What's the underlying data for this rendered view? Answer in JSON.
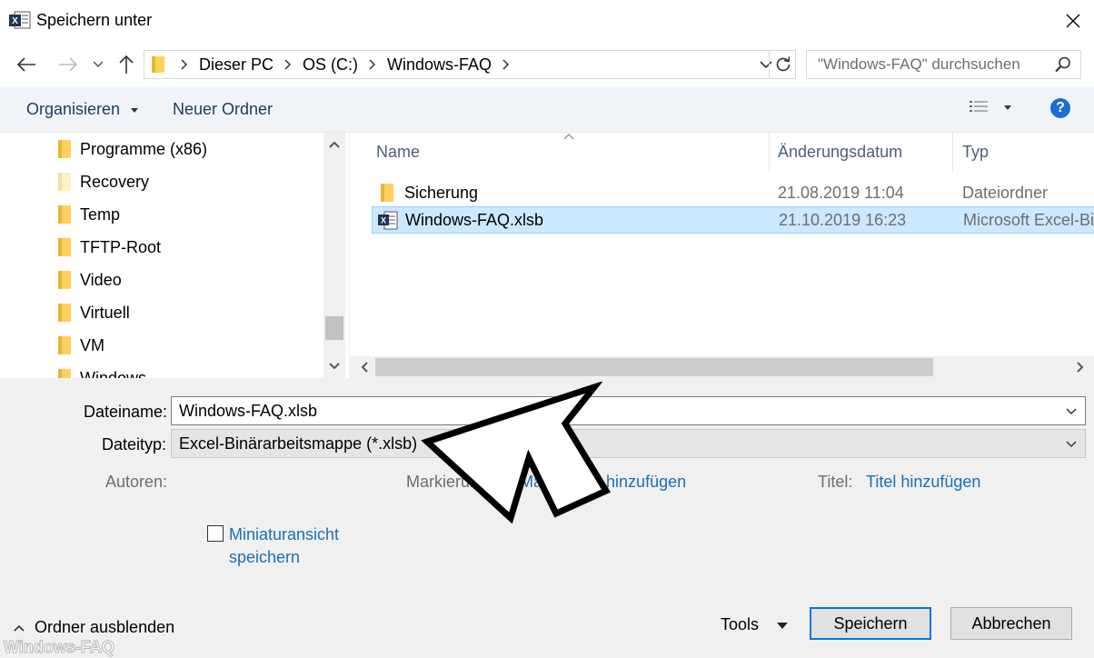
{
  "window": {
    "title": "Speichern unter"
  },
  "address": {
    "crumbs": [
      "Dieser PC",
      "OS (C:)",
      "Windows-FAQ"
    ],
    "search_placeholder": "\"Windows-FAQ\" durchsuchen"
  },
  "toolbar": {
    "organize": "Organisieren",
    "new_folder": "Neuer Ordner",
    "help": "?"
  },
  "nav": {
    "items": [
      "Programme (x86)",
      "Recovery",
      "Temp",
      "TFTP-Root",
      "Video",
      "Virtuell",
      "VM",
      "Windows"
    ]
  },
  "files": {
    "columns": {
      "name": "Name",
      "date": "Änderungsdatum",
      "type": "Typ"
    },
    "rows": [
      {
        "name": "Sicherung",
        "date": "21.08.2019 11:04",
        "type": "Dateiordner",
        "icon": "folder-icon"
      },
      {
        "name": "Windows-FAQ.xlsb",
        "date": "21.10.2019 16:23",
        "type": "Microsoft Excel-Bin",
        "icon": "excel-file-icon"
      }
    ]
  },
  "form": {
    "filename_label": "Dateiname:",
    "filename_value": "Windows-FAQ.xlsb",
    "filetype_label": "Dateityp:",
    "filetype_value": "Excel-Binärarbeitsmappe (*.xlsb)",
    "authors_label": "Autoren:",
    "tags_label": "Markierungen:",
    "tags_link": "Markierung hinzufügen",
    "title_label": "Titel:",
    "title_link": "Titel hinzufügen",
    "thumbnail_line1": "Miniaturansicht",
    "thumbnail_line2": "speichern"
  },
  "footer": {
    "hide_folders": "Ordner ausblenden",
    "tools": "Tools",
    "save": "Speichern",
    "cancel": "Abbrechen",
    "watermark": "Windows-FAQ"
  },
  "colors": {
    "accent": "#0078d7",
    "link": "#1a6fb5",
    "selection": "#cce8ff",
    "folder": "#ffd15c"
  }
}
